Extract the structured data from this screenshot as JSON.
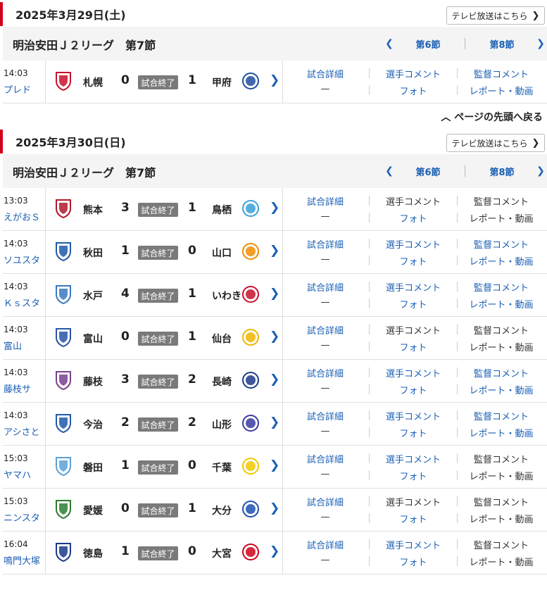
{
  "days": [
    {
      "date": "2025年3月29日(土)",
      "tv_button": "テレビ放送はこちら",
      "league": "明治安田Ｊ２リーグ　第7節",
      "prev_round": "第6節",
      "next_round": "第8節",
      "matches": [
        {
          "time": "14:03",
          "venue": "プレド",
          "home": "札幌",
          "home_score": "0",
          "status": "試合終了",
          "away_score": "1",
          "away": "甲府",
          "links": [
            "試合詳細",
            "選手コメント",
            "監督コメント",
            "—",
            "フォト",
            "レポート・動画"
          ],
          "link_colors": [
            "blue",
            "blue",
            "blue",
            "dark",
            "blue",
            "blue"
          ],
          "home_color": "#c8102e",
          "away_color": "#1e4fa0"
        }
      ]
    },
    {
      "date": "2025年3月30日(日)",
      "tv_button": "テレビ放送はこちら",
      "league": "明治安田Ｊ２リーグ　第7節",
      "prev_round": "第6節",
      "next_round": "第8節",
      "matches": [
        {
          "time": "13:03",
          "venue": "えがおＳ",
          "home": "熊本",
          "home_score": "3",
          "status": "試合終了",
          "away_score": "1",
          "away": "鳥栖",
          "links": [
            "試合詳細",
            "選手コメント",
            "監督コメント",
            "—",
            "フォト",
            "レポート・動画"
          ],
          "link_colors": [
            "blue",
            "dark",
            "dark",
            "dark",
            "blue",
            "dark"
          ],
          "home_color": "#b0172b",
          "away_color": "#3aa0d8"
        },
        {
          "time": "14:03",
          "venue": "ソユスタ",
          "home": "秋田",
          "home_score": "1",
          "status": "試合終了",
          "away_score": "0",
          "away": "山口",
          "links": [
            "試合詳細",
            "選手コメント",
            "監督コメント",
            "—",
            "フォト",
            "レポート・動画"
          ],
          "link_colors": [
            "blue",
            "blue",
            "blue",
            "dark",
            "blue",
            "blue"
          ],
          "home_color": "#1e5aa8",
          "away_color": "#f08c00"
        },
        {
          "time": "14:03",
          "venue": "Ｋｓスタ",
          "home": "水戸",
          "home_score": "4",
          "status": "試合終了",
          "away_score": "1",
          "away": "いわき",
          "links": [
            "試合詳細",
            "選手コメント",
            "監督コメント",
            "—",
            "フォト",
            "レポート・動画"
          ],
          "link_colors": [
            "blue",
            "blue",
            "blue",
            "dark",
            "blue",
            "blue"
          ],
          "home_color": "#3a78c0",
          "away_color": "#c8102e"
        },
        {
          "time": "14:03",
          "venue": "富山",
          "home": "富山",
          "home_score": "0",
          "status": "試合終了",
          "away_score": "1",
          "away": "仙台",
          "links": [
            "試合詳細",
            "選手コメント",
            "監督コメント",
            "—",
            "フォト",
            "レポート・動画"
          ],
          "link_colors": [
            "blue",
            "dark",
            "dark",
            "dark",
            "blue",
            "dark"
          ],
          "home_color": "#2856a8",
          "away_color": "#f0b400"
        },
        {
          "time": "14:03",
          "venue": "藤枝サ",
          "home": "藤枝",
          "home_score": "3",
          "status": "試合終了",
          "away_score": "2",
          "away": "長崎",
          "links": [
            "試合詳細",
            "選手コメント",
            "監督コメント",
            "—",
            "フォト",
            "レポート・動画"
          ],
          "link_colors": [
            "blue",
            "blue",
            "blue",
            "dark",
            "blue",
            "blue"
          ],
          "home_color": "#7a3f8f",
          "away_color": "#1e3a8a"
        },
        {
          "time": "14:03",
          "venue": "アシさと",
          "home": "今治",
          "home_score": "2",
          "status": "試合終了",
          "away_score": "2",
          "away": "山形",
          "links": [
            "試合詳細",
            "選手コメント",
            "監督コメント",
            "—",
            "フォト",
            "レポート・動画"
          ],
          "link_colors": [
            "blue",
            "blue",
            "blue",
            "dark",
            "blue",
            "blue"
          ],
          "home_color": "#1e5aa8",
          "away_color": "#3b3aa0"
        },
        {
          "time": "15:03",
          "venue": "ヤマハ",
          "home": "磐田",
          "home_score": "1",
          "status": "試合終了",
          "away_score": "0",
          "away": "千葉",
          "links": [
            "試合詳細",
            "選手コメント",
            "監督コメント",
            "—",
            "フォト",
            "レポート・動画"
          ],
          "link_colors": [
            "blue",
            "blue",
            "dark",
            "dark",
            "blue",
            "dark"
          ],
          "home_color": "#5aa0d8",
          "away_color": "#f0c800"
        },
        {
          "time": "15:03",
          "venue": "ニンスタ",
          "home": "愛媛",
          "home_score": "0",
          "status": "試合終了",
          "away_score": "1",
          "away": "大分",
          "links": [
            "試合詳細",
            "選手コメント",
            "監督コメント",
            "—",
            "フォト",
            "レポート・動画"
          ],
          "link_colors": [
            "blue",
            "dark",
            "dark",
            "dark",
            "blue",
            "dark"
          ],
          "home_color": "#2e7d32",
          "away_color": "#1e4fb0"
        },
        {
          "time": "16:04",
          "venue": "鳴門大塚",
          "home": "徳島",
          "home_score": "1",
          "status": "試合終了",
          "away_score": "0",
          "away": "大宮",
          "links": [
            "試合詳細",
            "選手コメント",
            "監督コメント",
            "—",
            "フォト",
            "レポート・動画"
          ],
          "link_colors": [
            "blue",
            "blue",
            "dark",
            "dark",
            "blue",
            "dark"
          ],
          "home_color": "#1a3a8a",
          "away_color": "#d0021b"
        }
      ]
    }
  ],
  "page_top_link": "ページの先頭へ戻る",
  "colors": {
    "accent_red": "#d0021b",
    "link_blue": "#1a5fb4",
    "status_gray": "#7a7a7a"
  },
  "icons": {
    "prev": "chevron-left-icon",
    "next": "chevron-right-icon",
    "go": "chevron-right-icon",
    "page_top": "chevron-up-icon"
  }
}
